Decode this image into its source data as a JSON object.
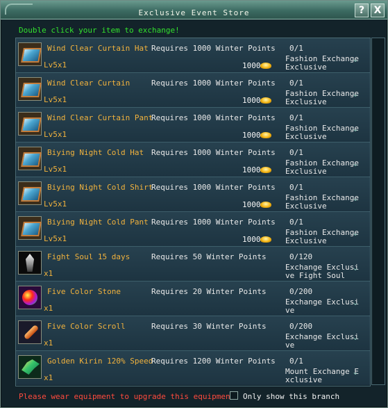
{
  "window": {
    "title": "Exclusive Event Store",
    "help_label": "?",
    "close_label": "X"
  },
  "hint": "Double click your item to exchange!",
  "items": [
    {
      "icon": "fashion-item-icon",
      "name": "Wind Clear Curtain Hat",
      "qty": "Lv5x1",
      "requirement": "Requires 1000 Winter Points",
      "cost": "1000",
      "count": "0/1",
      "category": "Fashion Exchange Exclusive"
    },
    {
      "icon": "fashion-item-icon",
      "name": "Wind Clear Curtain",
      "qty": "Lv5x1",
      "requirement": "Requires 1000 Winter Points",
      "cost": "1000",
      "count": "0/1",
      "category": "Fashion Exchange Exclusive"
    },
    {
      "icon": "fashion-item-icon",
      "name": "Wind Clear Curtain Pant",
      "qty": "Lv5x1",
      "requirement": "Requires 1000 Winter Points",
      "cost": "1000",
      "count": "0/1",
      "category": "Fashion Exchange Exclusive"
    },
    {
      "icon": "fashion-item-icon",
      "name": "Biying Night Cold Hat",
      "qty": "Lv5x1",
      "requirement": "Requires 1000 Winter Points",
      "cost": "1000",
      "count": "0/1",
      "category": "Fashion Exchange Exclusive"
    },
    {
      "icon": "fashion-item-icon",
      "name": "Biying Night Cold Shirt",
      "qty": "Lv5x1",
      "requirement": "Requires 1000 Winter Points",
      "cost": "1000",
      "count": "0/1",
      "category": "Fashion Exchange Exclusive"
    },
    {
      "icon": "fashion-item-icon",
      "name": "Biying Night Cold Pant",
      "qty": "Lv5x1",
      "requirement": "Requires 1000 Winter Points",
      "cost": "1000",
      "count": "0/1",
      "category": "Fashion Exchange Exclusive"
    },
    {
      "icon": "soul-crystal-icon",
      "name": "Fight Soul 15 days",
      "qty": "x1",
      "requirement": "Requires 50 Winter Points",
      "cost": "",
      "count": "0/120",
      "category": "Exchange Exclusive Fight Soul"
    },
    {
      "icon": "gem-stone-icon",
      "name": "Five Color Stone",
      "qty": "x1",
      "requirement": "Requires 20 Winter Points",
      "cost": "",
      "count": "0/200",
      "category": "Exchange Exclusive"
    },
    {
      "icon": "scroll-icon",
      "name": "Five Color Scroll",
      "qty": "x1",
      "requirement": "Requires 30 Winter Points",
      "cost": "",
      "count": "0/200",
      "category": "Exchange Exclusive"
    },
    {
      "icon": "kirin-mount-icon",
      "name": "Golden Kirin 120% Speed",
      "qty": "x1",
      "requirement": "Requires 1200 Winter Points",
      "cost": "",
      "count": "0/1",
      "category": "Mount Exchange Exclusive"
    }
  ],
  "footer": {
    "note": "Please wear equipment to upgrade this equipment!",
    "checkbox_label": "Only show this branch",
    "checkbox_checked": false
  }
}
